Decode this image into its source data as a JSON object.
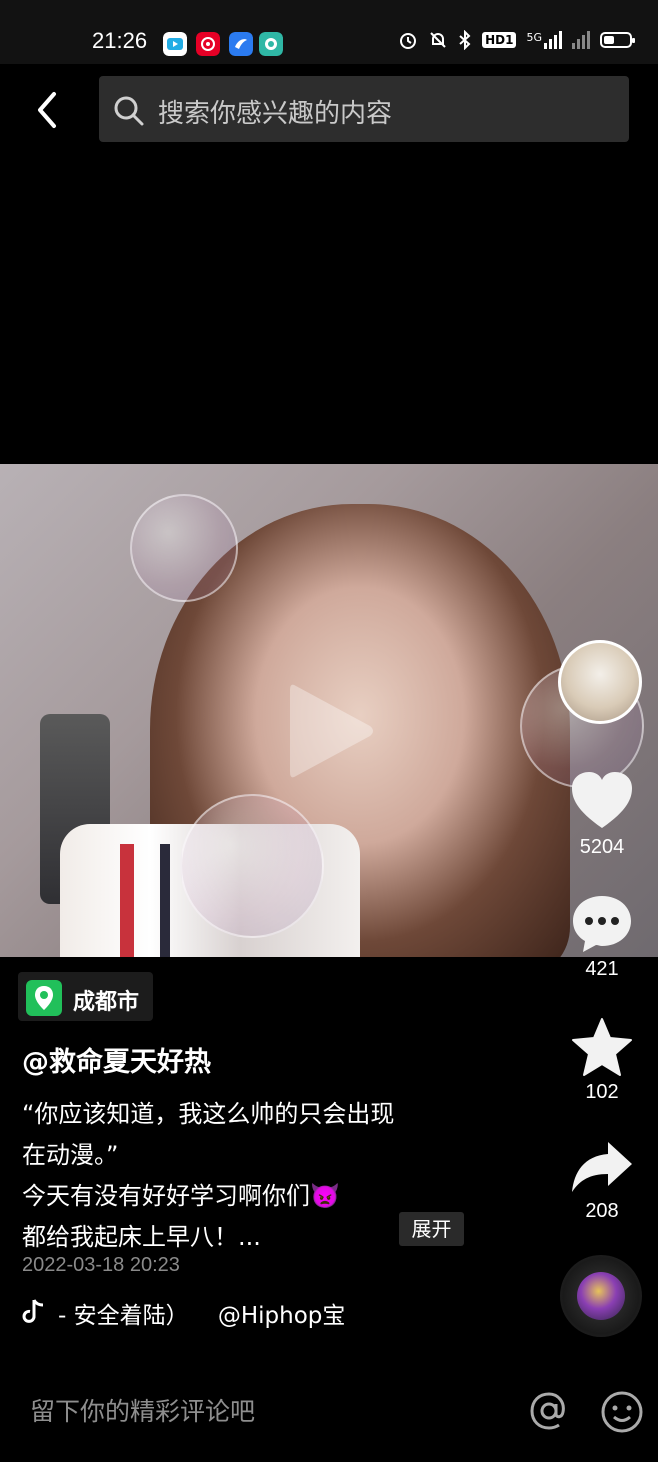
{
  "status_bar": {
    "time": "21:26",
    "apps": [
      "bilibili-app-icon",
      "netease-music-app-icon",
      "blue-app-icon",
      "teal-app-icon"
    ],
    "indicators": [
      "alarm-icon",
      "mute-bell-icon",
      "bluetooth-icon",
      "hd-icon",
      "signal-5g-icon",
      "signal-icon",
      "battery-icon"
    ],
    "hd_label": "HD1",
    "net_label": "5G"
  },
  "header": {
    "back_icon": "chevron-left-icon",
    "search_placeholder": "搜索你感兴趣的内容"
  },
  "video": {
    "play_icon": "play-icon"
  },
  "actions": {
    "likes": "5204",
    "comments": "421",
    "favorites": "102",
    "shares": "208"
  },
  "info": {
    "location": "成都市",
    "author": "@救命夏天好热",
    "desc_lines": [
      "“你应该知道，我这么帅的只会出现",
      "在动漫。”",
      "今天有没有好好学习啊你们",
      "都给我起床上早八！..."
    ],
    "desc_emoji": "👿",
    "expand": "展开",
    "date": "2022-03-18 20:23",
    "music": "- 安全着陆）    @Hiphop宝"
  },
  "comment_bar": {
    "placeholder": "留下你的精彩评论吧"
  },
  "colors": {
    "background": "#000000",
    "search_bg": "#2d2d2d",
    "location_green": "#21c05a",
    "muted_text": "#8a8a8a"
  }
}
